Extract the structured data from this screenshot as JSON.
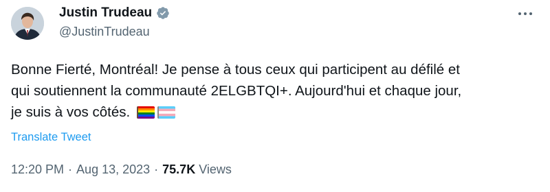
{
  "author": {
    "name": "Justin Trudeau",
    "handle": "@JustinTrudeau",
    "verified_icon": "verified-badge-icon",
    "avatar_icon": "avatar"
  },
  "menu": {
    "more_icon": "more-horizontal-icon"
  },
  "tweet": {
    "lines": [
      "Bonne Fierté, Montréal! Je pense à tous ceux qui participent au défilé et",
      "qui soutiennent la communauté 2ELGBTQI+. Aujourd'hui et chaque jour,",
      "je suis à vos côtés."
    ],
    "emoji": [
      "rainbow-flag-icon",
      "transgender-flag-icon"
    ]
  },
  "translate_label": "Translate Tweet",
  "meta": {
    "time": "12:20 PM",
    "separator": "·",
    "date": "Aug 13, 2023",
    "views_count": "75.7K",
    "views_label": "Views"
  },
  "colors": {
    "text": "#0f1419",
    "secondary": "#536471",
    "link": "#1d9bf0",
    "verified": "#829aab"
  }
}
